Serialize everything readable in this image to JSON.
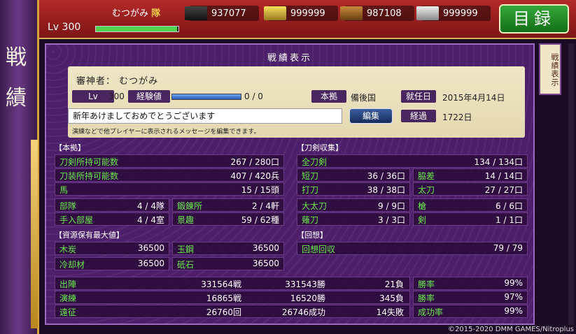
{
  "header": {
    "player_name": "むつがみ",
    "unit_mark": "隊",
    "level_label": "Lv",
    "level": "300",
    "exp_fraction": 0.98,
    "resources": [
      {
        "icon": "charcoal-icon",
        "value": "937077"
      },
      {
        "icon": "tamahagane-icon",
        "value": "999999"
      },
      {
        "icon": "cooling-material-icon",
        "value": "987108"
      },
      {
        "icon": "whetstone-icon",
        "value": "999999"
      }
    ],
    "catalog_button": "目録"
  },
  "side": {
    "title1": "戦",
    "title2": "績"
  },
  "panel": {
    "title": "戦績表示",
    "side_tab": "戦績表示"
  },
  "profile": {
    "name_line": "審神者： むつがみ",
    "lv_label": "Lv",
    "lv_value": "300",
    "exp_label": "経験値",
    "exp_value": "0 / 0",
    "base_label": "本拠",
    "base_value": "備後国",
    "appoint_label": "就任日",
    "appoint_value": "2015年4月14日",
    "message": "新年あけましておめでとうございます",
    "edit_button": "編集",
    "elapsed_label": "経過",
    "elapsed_value": "1722日",
    "note": "演練などで他プレイヤーに表示されるメッセージを編集できます。"
  },
  "honkyo": {
    "heading": "【本拠】",
    "rows": [
      {
        "k": "刀剣所持可能数",
        "v": "267 / 280口"
      },
      {
        "k": "刀装所持可能数",
        "v": "407 / 420兵"
      },
      {
        "k": "馬",
        "v": "15 / 15頭"
      }
    ],
    "pairs": [
      {
        "k": "部隊",
        "v": "4 / 4隊",
        "k2": "鍛錬所",
        "v2": "2 / 4軒"
      },
      {
        "k": "手入部屋",
        "v": "4 / 4室",
        "k2": "景趣",
        "v2": "59 / 62種"
      }
    ]
  },
  "resmax": {
    "heading": "【資源保有最大値】",
    "pairs": [
      {
        "k": "木炭",
        "v": "36500",
        "k2": "玉鋼",
        "v2": "36500"
      },
      {
        "k": "冷却材",
        "v": "36500",
        "k2": "砥石",
        "v2": "36500"
      }
    ]
  },
  "tokens": {
    "heading": "【刀剣収集】",
    "total": {
      "k": "全刀剣",
      "v": "134 / 134口"
    },
    "pairs": [
      {
        "k": "短刀",
        "v": "36 / 36口",
        "k2": "脇差",
        "v2": "14 / 14口"
      },
      {
        "k": "打刀",
        "v": "38 / 38口",
        "k2": "太刀",
        "v2": "27 / 27口"
      },
      {
        "k": "大太刀",
        "v": "9 / 9口",
        "k2": "槍",
        "v2": "6 / 6口"
      },
      {
        "k": "薙刀",
        "v": "3 / 3口",
        "k2": "剣",
        "v2": "1 / 1口"
      }
    ]
  },
  "kaiso": {
    "heading": "【回想】",
    "row": {
      "k": "回想回収",
      "v": "79 / 79"
    }
  },
  "battle": [
    {
      "k": "出陣",
      "a": "331564戦",
      "b": "331543勝",
      "c": "21負",
      "rk": "勝率",
      "rv": "99%"
    },
    {
      "k": "演練",
      "a": "16865戦",
      "b": "16520勝",
      "c": "345負",
      "rk": "勝率",
      "rv": "97%"
    },
    {
      "k": "遠征",
      "a": "26760回",
      "b": "26746成功",
      "c": "14失敗",
      "rk": "成功率",
      "rv": "99%"
    }
  ],
  "copyright": "©2015-2020 DMM GAMES/Nitroplus"
}
